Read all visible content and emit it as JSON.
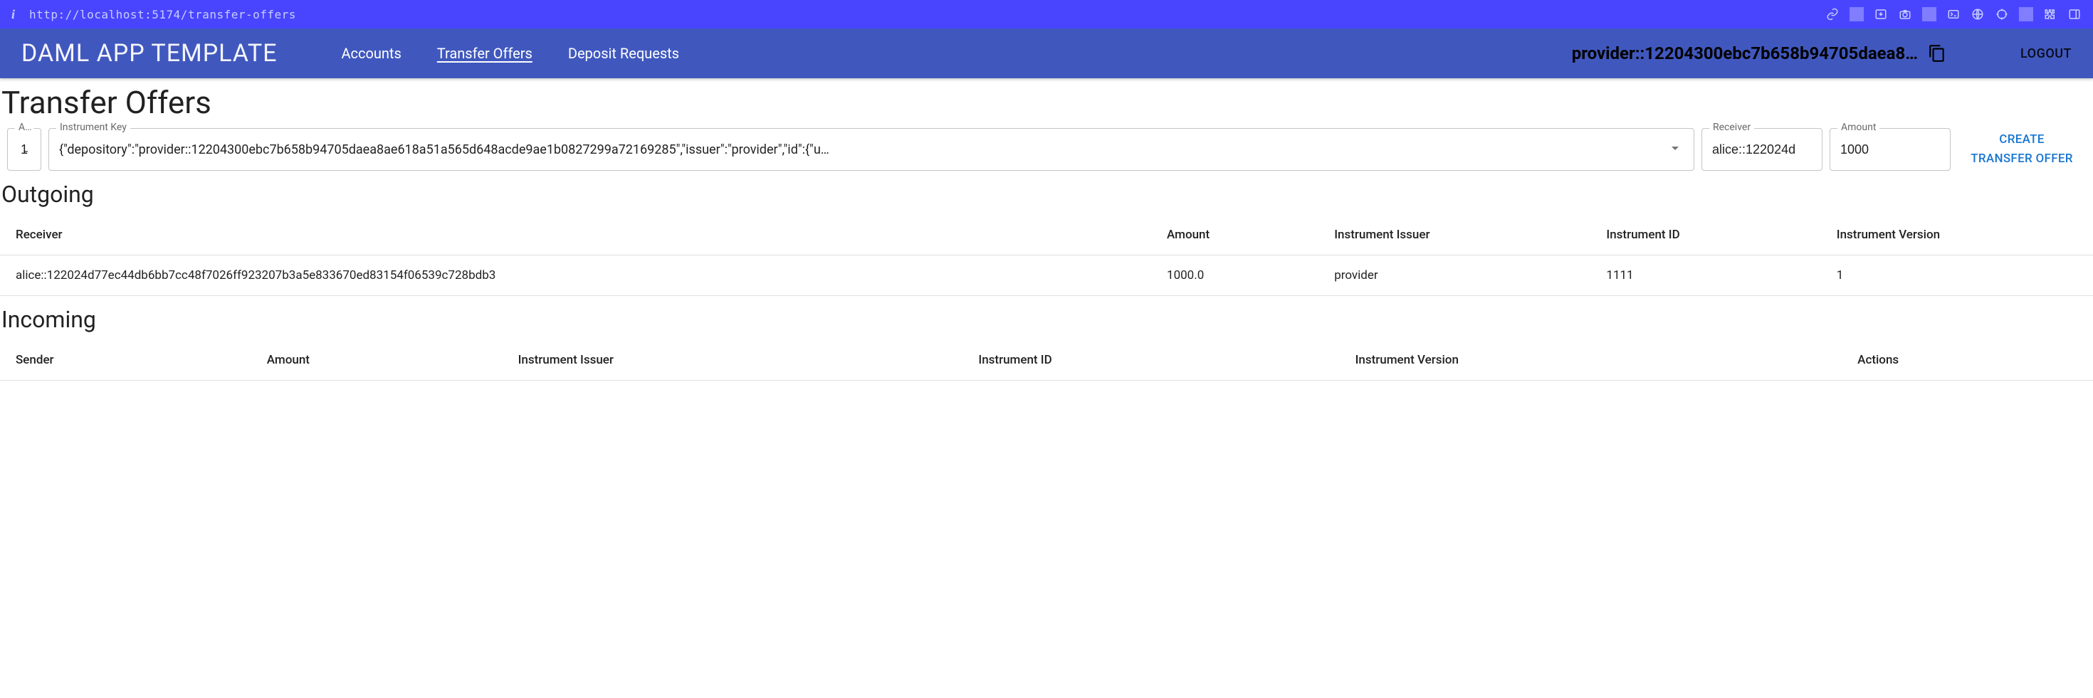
{
  "devbar": {
    "url": "http://localhost:5174/transfer-offers"
  },
  "appbar": {
    "title": "DAML APP TEMPLATE",
    "nav": {
      "accounts": "Accounts",
      "transfer_offers": "Transfer Offers",
      "deposit_requests": "Deposit Requests"
    },
    "party": "provider::12204300ebc7b658b94705daea8…",
    "logout": "LOGOUT"
  },
  "page": {
    "title": "Transfer Offers",
    "outgoing_heading": "Outgoing",
    "incoming_heading": "Incoming"
  },
  "form": {
    "account": {
      "label": "A..",
      "value": "1̶"
    },
    "instrument": {
      "label": "Instrument Key",
      "value": "{\"depository\":\"provider::12204300ebc7b658b94705daea8ae618a51a565d648acde9ae1b0827299a72169285\",\"issuer\":\"provider\",\"id\":{\"u…"
    },
    "receiver": {
      "label": "Receiver",
      "value": "alice::122024d"
    },
    "amount": {
      "label": "Amount",
      "value": "1000"
    },
    "create_label_1": "CREATE",
    "create_label_2": "TRANSFER OFFER"
  },
  "outgoing": {
    "headers": {
      "receiver": "Receiver",
      "amount": "Amount",
      "issuer": "Instrument Issuer",
      "id": "Instrument ID",
      "version": "Instrument Version"
    },
    "rows": [
      {
        "receiver": "alice::122024d77ec44db6bb7cc48f7026ff923207b3a5e833670ed83154f06539c728bdb3",
        "amount": "1000.0",
        "issuer": "provider",
        "id": "1111",
        "version": "1"
      }
    ]
  },
  "incoming": {
    "headers": {
      "sender": "Sender",
      "amount": "Amount",
      "issuer": "Instrument Issuer",
      "id": "Instrument ID",
      "version": "Instrument Version",
      "actions": "Actions"
    }
  }
}
